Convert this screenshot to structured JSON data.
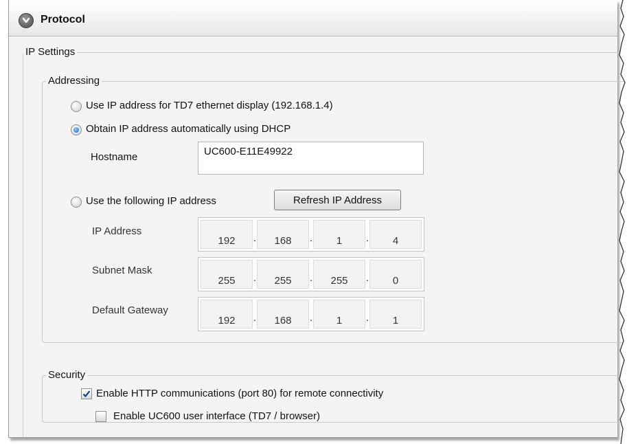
{
  "header": {
    "title": "Protocol",
    "collapse_icon": "chevron-down-icon"
  },
  "ip_settings": {
    "legend": "IP Settings",
    "addressing": {
      "legend": "Addressing",
      "options": [
        {
          "label": "Use IP address for TD7 ethernet display (192.168.1.4)",
          "selected": false
        },
        {
          "label": "Obtain IP address automatically using DHCP",
          "selected": true
        },
        {
          "label": "Use the following IP address",
          "selected": false
        }
      ],
      "hostname_label": "Hostname",
      "hostname_value": "UC600-E11E49922",
      "refresh_button": "Refresh IP Address",
      "ip_address": {
        "label": "IP Address",
        "octets": [
          "192",
          "168",
          "1",
          "4"
        ]
      },
      "subnet_mask": {
        "label": "Subnet Mask",
        "octets": [
          "255",
          "255",
          "255",
          "0"
        ]
      },
      "default_gateway": {
        "label": "Default Gateway",
        "octets": [
          "192",
          "168",
          "1",
          "1"
        ]
      },
      "separator": "."
    },
    "security": {
      "legend": "Security",
      "http": {
        "label": "Enable HTTP communications (port 80) for remote connectivity",
        "checked": true
      },
      "ui": {
        "label": "Enable UC600 user interface (TD7 / browser)",
        "checked": false
      }
    }
  },
  "colors": {
    "radio_selected": "#1563b8",
    "checkmark": "#1a3f8f",
    "panel_bg": "#f4f4f4"
  }
}
